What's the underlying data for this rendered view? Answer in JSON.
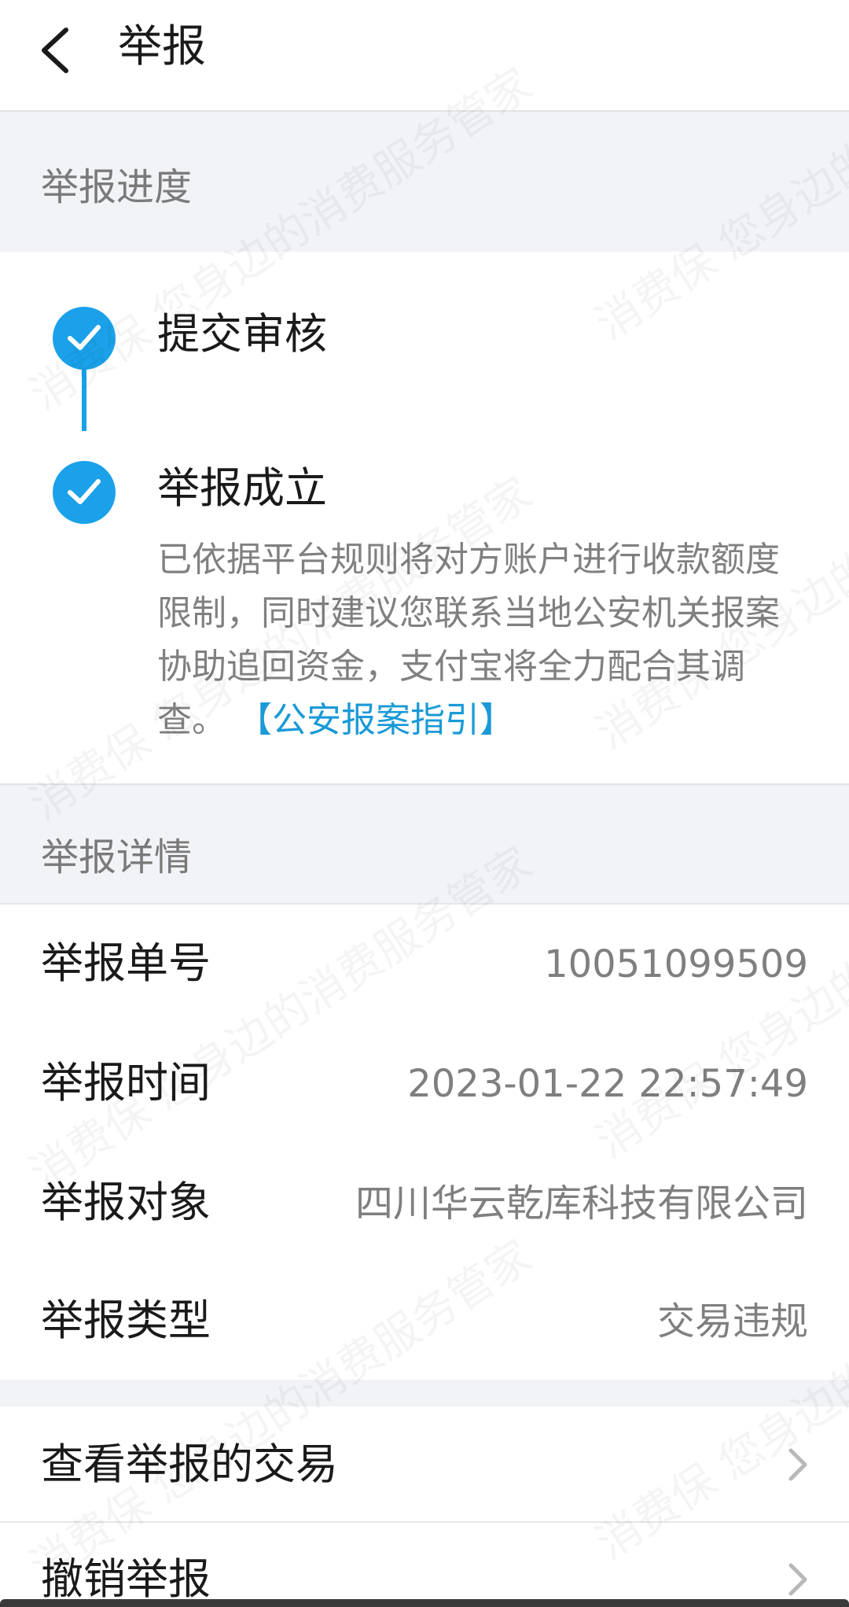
{
  "header": {
    "title": "举报"
  },
  "progress": {
    "heading": "举报进度",
    "steps": [
      {
        "label": "提交审核"
      },
      {
        "label": "举报成立",
        "description": "已依据平台规则将对方账户进行收款额度限制，同时建议您联系当地公安机关报案协助追回资金，支付宝将全力配合其调查。",
        "link": "【公安报案指引】"
      }
    ]
  },
  "details": {
    "heading": "举报详情",
    "rows": [
      {
        "label": "举报单号",
        "value": "10051099509"
      },
      {
        "label": "举报时间",
        "value": "2023-01-22 22:57:49"
      },
      {
        "label": "举报对象",
        "value": "四川华云乾库科技有限公司"
      },
      {
        "label": "举报类型",
        "value": "交易违规"
      }
    ]
  },
  "actions": [
    {
      "label": "查看举报的交易"
    },
    {
      "label": "撤销举报"
    }
  ],
  "watermark": {
    "text": "消费保 您身边的消费服务管家"
  },
  "colors": {
    "accent": "#1aa1ea",
    "link": "#1a9ad6",
    "section_bg": "#f2f3f7"
  }
}
